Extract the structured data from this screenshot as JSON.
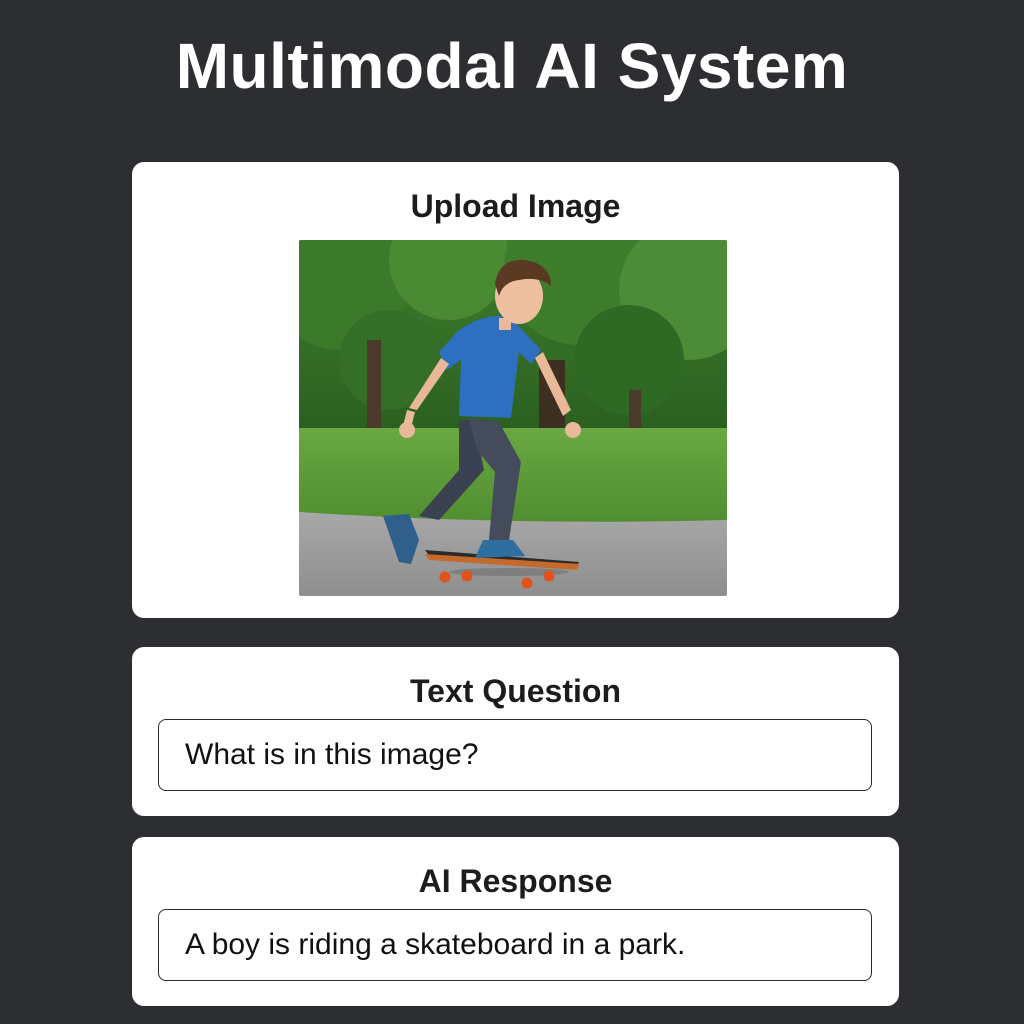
{
  "app": {
    "title": "Multimodal AI System"
  },
  "upload": {
    "heading": "Upload Image",
    "image_description": "uploaded-photo"
  },
  "question": {
    "heading": "Text Question",
    "value": "What is in this image?"
  },
  "response": {
    "heading": "AI Response",
    "value": "A boy is riding a skateboard in a park."
  },
  "colors": {
    "background": "#2d2e32",
    "card": "#ffffff",
    "title_text": "#ffffff",
    "shirt": "#2f6fc0",
    "grass": "#5b9a3a",
    "trees": "#2f6a25",
    "path": "#9e9e9e"
  }
}
